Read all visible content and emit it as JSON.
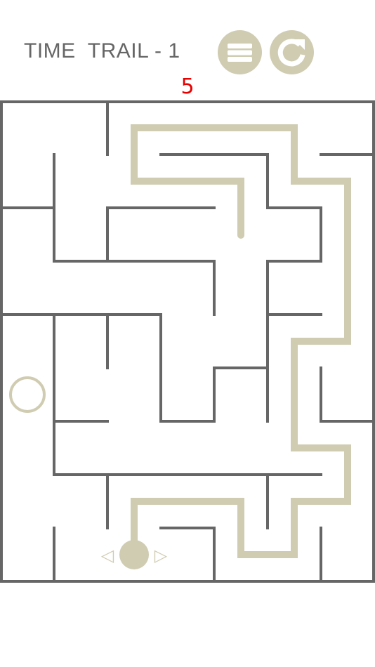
{
  "header": {
    "title": "TIME  TRAIL - 1",
    "menu_icon": "hamburger-icon",
    "restart_icon": "restart-icon"
  },
  "timer": {
    "value": "5"
  },
  "colors": {
    "wall": "#666666",
    "trail": "#d0ccb2",
    "timer": "#e60000",
    "background": "#ffffff"
  },
  "controls": {
    "left_arrow": "◁",
    "right_arrow": "▷"
  }
}
